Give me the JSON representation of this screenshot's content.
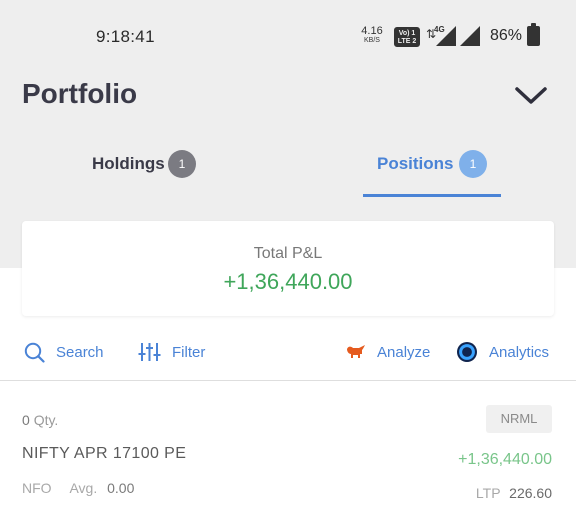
{
  "status_bar": {
    "time": "9:18:41",
    "net_speed_value": "4.16",
    "net_speed_unit": "KB/S",
    "volte_line1": "Vo) 1",
    "volte_line2": "LTE 2",
    "network_tag": "4G",
    "battery": "86%"
  },
  "header": {
    "title": "Portfolio"
  },
  "tabs": [
    {
      "label": "Holdings",
      "count": "1",
      "active": false
    },
    {
      "label": "Positions",
      "count": "1",
      "active": true
    }
  ],
  "pnl_card": {
    "label": "Total P&L",
    "value": "+1,36,440.00"
  },
  "toolbar": {
    "search": "Search",
    "filter": "Filter",
    "analyze": "Analyze",
    "analytics": "Analytics"
  },
  "positions": [
    {
      "qty_value": "0",
      "qty_label": "Qty.",
      "product": "NRML",
      "symbol": "NIFTY APR 17100 PE",
      "pnl": "+1,36,440.00",
      "exchange": "NFO",
      "avg_label": "Avg.",
      "avg_value": "0.00",
      "ltp_label": "LTP",
      "ltp_value": "226.60"
    }
  ],
  "colors": {
    "accent": "#4a83d6",
    "profit": "#3fa65a",
    "header_bg": "#eeeeee"
  }
}
